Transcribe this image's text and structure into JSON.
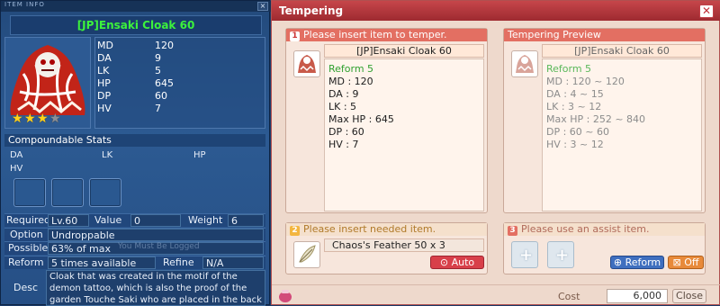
{
  "item_info": {
    "window_title": "ITEM INFO",
    "item_name": "[JP]Ensaki Cloak 60",
    "stars": [
      true,
      true,
      true,
      false
    ],
    "stats": [
      {
        "label": "MD",
        "value": "120"
      },
      {
        "label": "DA",
        "value": "9"
      },
      {
        "label": "LK",
        "value": "5"
      },
      {
        "label": "HP",
        "value": "645"
      },
      {
        "label": "DP",
        "value": "60"
      },
      {
        "label": "HV",
        "value": "7"
      }
    ],
    "compoundable_title": "Compoundable Stats",
    "compoundable": [
      "DA",
      "LK",
      "HP",
      "HV"
    ],
    "required_label": "Required",
    "required_value": "Lv.60",
    "value_label": "Value",
    "value_value": "0",
    "weight_label": "Weight",
    "weight_value": "6",
    "option_label": "Option",
    "option_value": "Undroppable",
    "possible_label": "Possible",
    "possible_value": "63% of max",
    "reform_label": "Reform",
    "reform_value": "5 times available",
    "refine_label": "Refine",
    "refine_value": "N/A",
    "desc_label": "Desc",
    "desc_text": "Cloak that was created in the motif of the demon tattoo, which is also the proof of the garden Touche Saki who are placed in the back of Mion",
    "watermark": "You Must Be Logged"
  },
  "tempering": {
    "title": "Tempering",
    "section1_num": "1",
    "section1_label": "Please insert item to temper.",
    "preview_label": "Tempering Preview",
    "item_name": "[JP]Ensaki Cloak 60",
    "current_stats": [
      {
        "text": "Reform 5",
        "green": true
      },
      {
        "text": "MD : 120"
      },
      {
        "text": "DA : 9"
      },
      {
        "text": "LK : 5"
      },
      {
        "text": "Max HP : 645"
      },
      {
        "text": "DP : 60"
      },
      {
        "text": "HV : 7"
      }
    ],
    "preview_stats": [
      {
        "text": "Reform 5",
        "green": true
      },
      {
        "text": "MD : 120 ~ 120"
      },
      {
        "text": "DA : 4 ~ 15"
      },
      {
        "text": "LK : 3 ~ 12"
      },
      {
        "text": "Max HP : 252 ~ 840"
      },
      {
        "text": "DP : 60 ~ 60"
      },
      {
        "text": "HV : 3 ~ 12"
      }
    ],
    "section2_num": "2",
    "section2_label": "Please insert needed item.",
    "needed_item": "Chaos's Feather 50 x 3",
    "auto_button": "Auto",
    "section3_num": "3",
    "section3_label": "Please use an assist item.",
    "reform_button": "Reform",
    "off_button": "Off",
    "cost_label": "Cost",
    "cost_value": "6,000",
    "close_button": "Close",
    "colors": {
      "header": "#e36f62",
      "title_bar": "#b0363c",
      "auto": "#d8404a",
      "reform": "#3f6fbf",
      "off": "#e88a3a"
    }
  }
}
